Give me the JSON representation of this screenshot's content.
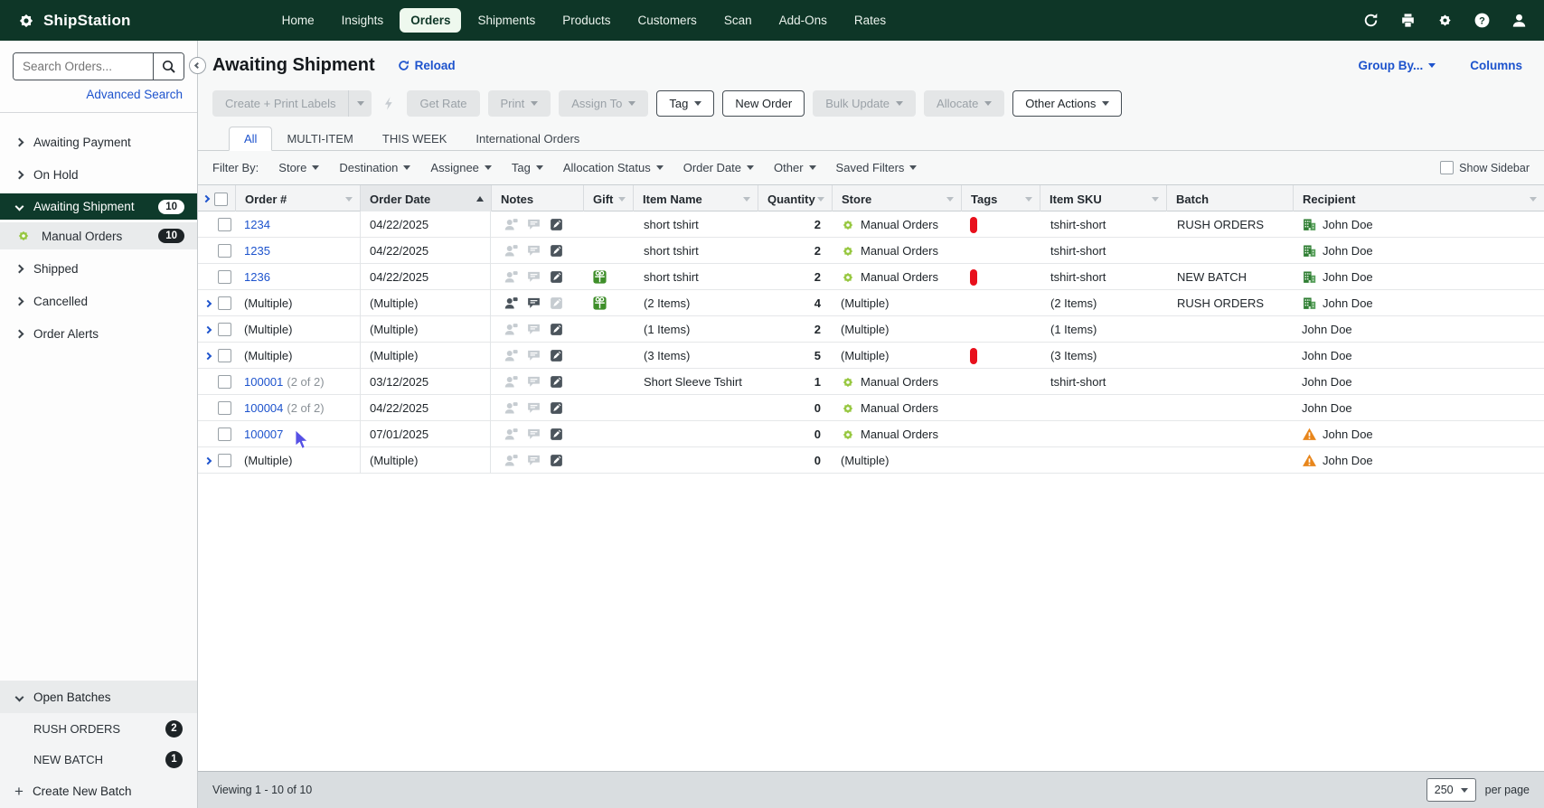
{
  "colors": {
    "navbar_green": "#0e3627",
    "selected_green": "#0e3a2b",
    "accent_blue": "#1d53cd",
    "tag_red": "#e8101c",
    "store_gear_green": "#96c73f",
    "gift_green": "#3f8f2a",
    "building_green": "#2e7d32",
    "warning_orange": "#e8861b"
  },
  "navbar": {
    "brand": "ShipStation",
    "items": [
      {
        "label": "Home",
        "active": false
      },
      {
        "label": "Insights",
        "active": false
      },
      {
        "label": "Orders",
        "active": true
      },
      {
        "label": "Shipments",
        "active": false
      },
      {
        "label": "Products",
        "active": false
      },
      {
        "label": "Customers",
        "active": false
      },
      {
        "label": "Scan",
        "active": false
      },
      {
        "label": "Add-Ons",
        "active": false
      },
      {
        "label": "Rates",
        "active": false
      }
    ],
    "icons": [
      "refresh-icon",
      "printer-icon",
      "gear-icon",
      "help-icon",
      "user-icon"
    ]
  },
  "sidebar": {
    "search_placeholder": "Search Orders...",
    "advanced_search": "Advanced Search",
    "nav": [
      {
        "label": "Awaiting Payment",
        "chevron": "right"
      },
      {
        "label": "On Hold",
        "chevron": "right"
      },
      {
        "label": "Awaiting Shipment",
        "chevron": "down",
        "badge": "10",
        "selected": true
      },
      {
        "label": "Manual Orders",
        "icon": "store-gear",
        "badge": "10",
        "child": true
      },
      {
        "label": "Shipped",
        "chevron": "right"
      },
      {
        "label": "Cancelled",
        "chevron": "right"
      },
      {
        "label": "Order Alerts",
        "chevron": "right"
      }
    ],
    "batches": {
      "title": "Open Batches",
      "items": [
        {
          "label": "RUSH ORDERS",
          "badge": "2"
        },
        {
          "label": "NEW BATCH",
          "badge": "1"
        }
      ],
      "create_label": "Create New Batch"
    }
  },
  "header": {
    "title": "Awaiting Shipment",
    "reload_label": "Reload",
    "group_by_label": "Group By...",
    "columns_label": "Columns"
  },
  "toolbar": {
    "buttons": [
      {
        "label": "Create + Print Labels",
        "disabled": true,
        "split": true
      },
      {
        "icon": "bolt-icon",
        "disabled": true
      },
      {
        "label": "Get Rate",
        "disabled": true
      },
      {
        "label": "Print",
        "caret": true,
        "disabled": true
      },
      {
        "label": "Assign To",
        "caret": true,
        "disabled": true
      },
      {
        "label": "Tag",
        "caret": true,
        "disabled": false
      },
      {
        "label": "New Order",
        "disabled": false
      },
      {
        "label": "Bulk Update",
        "caret": true,
        "disabled": true
      },
      {
        "label": "Allocate",
        "caret": true,
        "disabled": true
      },
      {
        "label": "Other Actions",
        "caret": true,
        "disabled": false
      }
    ]
  },
  "tabs": [
    {
      "label": "All",
      "active": true
    },
    {
      "label": "MULTI-ITEM",
      "active": false
    },
    {
      "label": "THIS WEEK",
      "active": false
    },
    {
      "label": "International Orders",
      "active": false
    }
  ],
  "filters": {
    "label": "Filter By:",
    "items": [
      "Store",
      "Destination",
      "Assignee",
      "Tag",
      "Allocation Status",
      "Order Date",
      "Other",
      "Saved Filters"
    ],
    "show_sidebar_label": "Show Sidebar"
  },
  "table": {
    "columns": [
      {
        "label": "Order #",
        "filter": true
      },
      {
        "label": "Order Date",
        "sorted": "asc"
      },
      {
        "label": "Notes",
        "filter": false
      },
      {
        "label": "Gift",
        "filter": true
      },
      {
        "label": "Item Name",
        "filter": true
      },
      {
        "label": "Quantity",
        "filter": true
      },
      {
        "label": "Store",
        "filter": true
      },
      {
        "label": "Tags",
        "filter": true
      },
      {
        "label": "Item SKU",
        "filter": true
      },
      {
        "label": "Batch",
        "filter": false
      },
      {
        "label": "Recipient",
        "filter": true
      }
    ],
    "rows": [
      {
        "expand": false,
        "order": "1234",
        "suffix": "",
        "link": true,
        "date": "04/22/2025",
        "person": false,
        "bubble": false,
        "edit": "dark",
        "gift": false,
        "item": "short tshirt",
        "qty": "2",
        "store": "Manual Orders",
        "store_icon": true,
        "tag": true,
        "sku": "tshirt-short",
        "batch": "RUSH ORDERS",
        "rec_icon": "building",
        "recipient": "John Doe"
      },
      {
        "expand": false,
        "order": "1235",
        "suffix": "",
        "link": true,
        "date": "04/22/2025",
        "person": false,
        "bubble": false,
        "edit": "dark",
        "gift": false,
        "item": "short tshirt",
        "qty": "2",
        "store": "Manual Orders",
        "store_icon": true,
        "tag": false,
        "sku": "tshirt-short",
        "batch": "",
        "rec_icon": "building",
        "recipient": "John Doe"
      },
      {
        "expand": false,
        "order": "1236",
        "suffix": "",
        "link": true,
        "date": "04/22/2025",
        "person": false,
        "bubble": false,
        "edit": "dark",
        "gift": true,
        "item": "short tshirt",
        "qty": "2",
        "store": "Manual Orders",
        "store_icon": true,
        "tag": true,
        "sku": "tshirt-short",
        "batch": "NEW BATCH",
        "rec_icon": "building",
        "recipient": "John Doe"
      },
      {
        "expand": true,
        "order": "(Multiple)",
        "suffix": "",
        "link": false,
        "date": "(Multiple)",
        "person": true,
        "bubble": true,
        "edit": "light",
        "gift": true,
        "item": "(2 Items)",
        "qty": "4",
        "store": "(Multiple)",
        "store_icon": false,
        "tag": false,
        "sku": "(2 Items)",
        "batch": "RUSH ORDERS",
        "rec_icon": "building",
        "recipient": "John Doe"
      },
      {
        "expand": true,
        "order": "(Multiple)",
        "suffix": "",
        "link": false,
        "date": "(Multiple)",
        "person": false,
        "bubble": false,
        "edit": "dark",
        "gift": false,
        "item": "(1 Items)",
        "qty": "2",
        "store": "(Multiple)",
        "store_icon": false,
        "tag": false,
        "sku": "(1 Items)",
        "batch": "",
        "rec_icon": "none",
        "recipient": "John Doe"
      },
      {
        "expand": true,
        "order": "(Multiple)",
        "suffix": "",
        "link": false,
        "date": "(Multiple)",
        "person": false,
        "bubble": false,
        "edit": "dark",
        "gift": false,
        "item": "(3 Items)",
        "qty": "5",
        "store": "(Multiple)",
        "store_icon": false,
        "tag": true,
        "sku": "(3 Items)",
        "batch": "",
        "rec_icon": "none",
        "recipient": "John Doe"
      },
      {
        "expand": false,
        "order": "100001",
        "suffix": "(2 of 2)",
        "link": true,
        "date": "03/12/2025",
        "person": false,
        "bubble": false,
        "edit": "dark",
        "gift": false,
        "item": "Short Sleeve Tshirt",
        "qty": "1",
        "store": "Manual Orders",
        "store_icon": true,
        "tag": false,
        "sku": "tshirt-short",
        "batch": "",
        "rec_icon": "none",
        "recipient": "John Doe"
      },
      {
        "expand": false,
        "order": "100004",
        "suffix": "(2 of 2)",
        "link": true,
        "date": "04/22/2025",
        "person": false,
        "bubble": false,
        "edit": "dark",
        "gift": false,
        "item": "",
        "qty": "0",
        "store": "Manual Orders",
        "store_icon": true,
        "tag": false,
        "sku": "",
        "batch": "",
        "rec_icon": "none",
        "recipient": "John Doe"
      },
      {
        "expand": false,
        "order": "100007",
        "suffix": "",
        "link": true,
        "date": "07/01/2025",
        "person": false,
        "bubble": false,
        "edit": "dark",
        "gift": false,
        "item": "",
        "qty": "0",
        "store": "Manual Orders",
        "store_icon": true,
        "tag": false,
        "sku": "",
        "batch": "",
        "rec_icon": "warning",
        "recipient": "John Doe"
      },
      {
        "expand": true,
        "order": "(Multiple)",
        "suffix": "",
        "link": false,
        "date": "(Multiple)",
        "person": false,
        "bubble": false,
        "edit": "dark",
        "gift": false,
        "item": "",
        "qty": "0",
        "store": "(Multiple)",
        "store_icon": false,
        "tag": false,
        "sku": "",
        "batch": "",
        "rec_icon": "warning",
        "recipient": "John Doe"
      }
    ]
  },
  "footer": {
    "viewing": "Viewing 1 - 10 of 10",
    "per_page_value": "250",
    "per_page_label": "per page"
  }
}
